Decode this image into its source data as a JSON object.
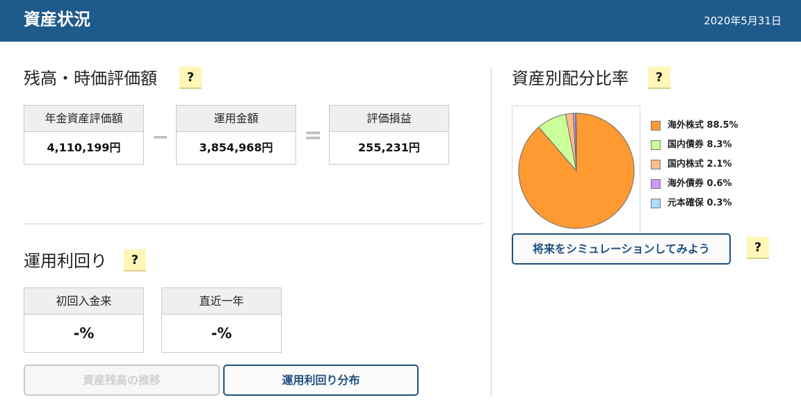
{
  "header": {
    "title": "資産状況",
    "date": "2020年5月31日"
  },
  "balance": {
    "title": "残高・時価評価額",
    "help": "?",
    "boxes": [
      {
        "label": "年金資産評価額",
        "value": "4,110,199円"
      },
      {
        "label": "運用金額",
        "value": "3,854,968円"
      },
      {
        "label": "評価損益",
        "value": "255,231円"
      }
    ],
    "minus": "−",
    "equals": "="
  },
  "returns": {
    "title": "運用利回り",
    "help": "?",
    "boxes": [
      {
        "label": "初回入金来",
        "value": "-%"
      },
      {
        "label": "直近一年",
        "value": "-%"
      }
    ],
    "buttons": {
      "history": "資産残高の推移",
      "distribution": "運用利回り分布"
    }
  },
  "allocation": {
    "title": "資産別配分比率",
    "help": "?",
    "simulate_button": "将来をシミュレーションしてみよう",
    "simulate_help": "?"
  },
  "chart_data": {
    "type": "pie",
    "title": "",
    "slices": [
      {
        "label": "海外株式",
        "value": 88.5,
        "display": "海外株式 88.5%",
        "color": "#ff9a33"
      },
      {
        "label": "国内債券",
        "value": 8.3,
        "display": "国内債券 8.3%",
        "color": "#ccff99"
      },
      {
        "label": "国内株式",
        "value": 2.1,
        "display": "国内株式 2.1%",
        "color": "#ffbb88"
      },
      {
        "label": "海外債券",
        "value": 0.6,
        "display": "海外債券 0.6%",
        "color": "#cc99ff"
      },
      {
        "label": "元本確保",
        "value": 0.3,
        "display": "元本確保 0.3%",
        "color": "#aaddff"
      }
    ],
    "legend_position": "right"
  }
}
